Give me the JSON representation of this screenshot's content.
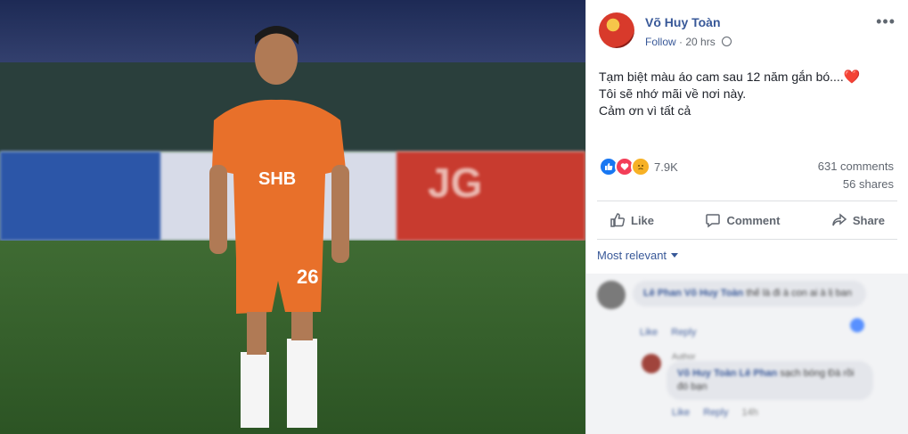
{
  "post": {
    "author": "Võ Huy Toàn",
    "follow_label": "Follow",
    "time": "20 hrs",
    "lines": [
      "Tạm biệt màu áo cam sau 12 năm gắn bó....",
      "Tôi sẽ nhớ mãi về nơi này.",
      "Cảm ơn vì tất cả"
    ],
    "heart_glyph": "❤️"
  },
  "photo": {
    "jersey_number": "26",
    "sponsor": "SHB",
    "board_text": "JG"
  },
  "reactions": {
    "count": "7.9K",
    "types": [
      "like-icon",
      "love-icon",
      "sad-icon"
    ]
  },
  "stats": {
    "comments": "631 comments",
    "shares": "56 shares"
  },
  "actions": {
    "like": "Like",
    "comment": "Comment",
    "share": "Share"
  },
  "sort": {
    "label": "Most relevant"
  },
  "comments": [
    {
      "author": "Lê Phan",
      "mention": "Võ Huy Toàn",
      "text": "thế là đi à con ai à lị ban",
      "actions": [
        "Like",
        "Reply"
      ]
    }
  ],
  "replies": [
    {
      "badge": "Author",
      "author": "Võ Huy Toàn",
      "mention": "Lê Phan",
      "text": "sạch bóng Đà rồi đó bạn",
      "actions": [
        "Like",
        "Reply",
        "14h"
      ]
    }
  ],
  "colors": {
    "link": "#385898",
    "like_blue": "#1877f2",
    "love_red": "#f33e58",
    "sad_yellow": "#f7b125",
    "jersey_orange": "#e8702a"
  }
}
